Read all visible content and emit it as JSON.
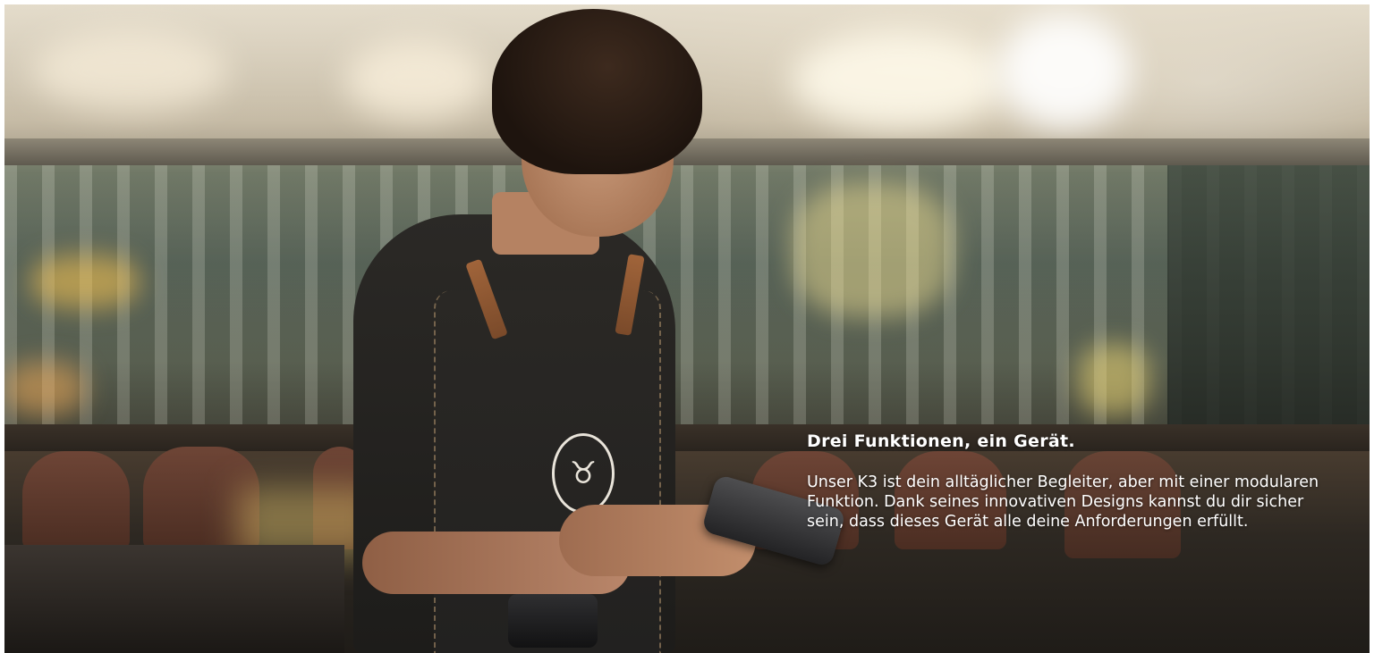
{
  "hero": {
    "heading": "Drei Funktionen, ein Gerät.",
    "body": "Unser K3 ist dein alltäglicher Begleiter, aber mit einer modularen Funktion. Dank seines innovativen Designs kannst du dir sicher sein, dass dieses Gerät alle deine Anforderungen erfüllt."
  },
  "colors": {
    "text": "#ffffff",
    "apron": "#2a2825",
    "strap": "#a0643a"
  }
}
